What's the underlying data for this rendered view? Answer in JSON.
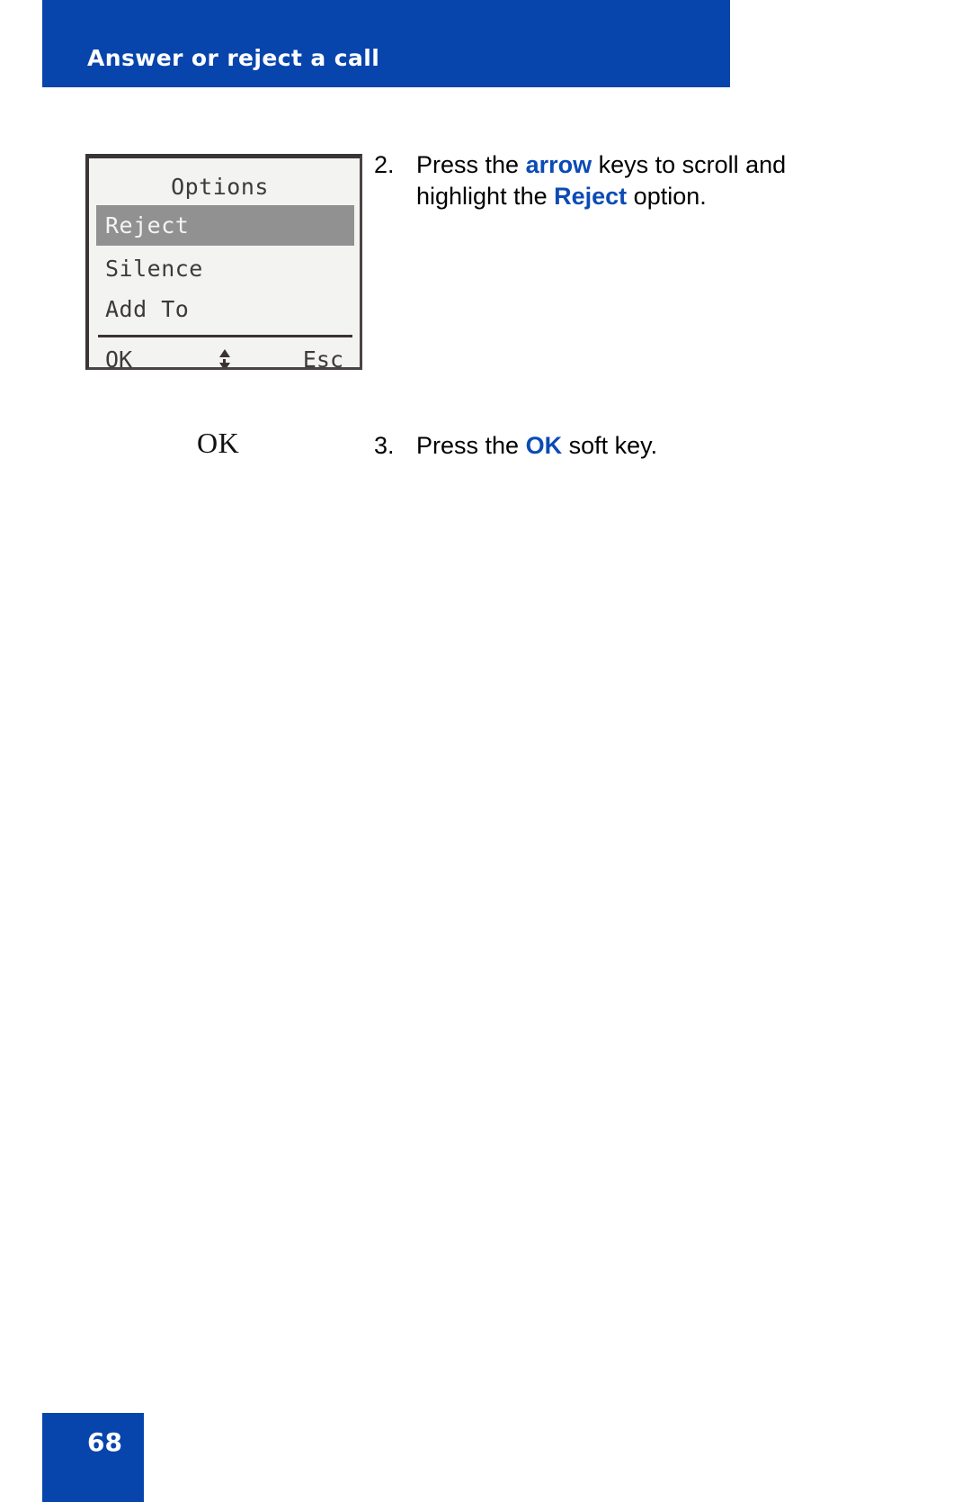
{
  "header": {
    "title": "Answer or reject a call",
    "background_color": "#0745ad",
    "text_color": "#ffffff"
  },
  "lcd_screen": {
    "title": "Options",
    "menu_items": [
      {
        "label": "Reject",
        "selected": true
      },
      {
        "label": "Silence",
        "selected": false
      },
      {
        "label": "Add To",
        "selected": false
      }
    ],
    "softkeys": {
      "left": "OK",
      "right": "Esc",
      "scroll_indicator": "up-down-arrows"
    },
    "highlight_color": "#919191",
    "screen_color": "#f3f3f1"
  },
  "softkey_glyph": {
    "label": "OK"
  },
  "steps": [
    {
      "number": "2.",
      "segments": [
        {
          "text": "Press the ",
          "highlight": false
        },
        {
          "text": "arrow",
          "highlight": true
        },
        {
          "text": " keys to scroll and highlight the ",
          "highlight": false
        },
        {
          "text": "Reject",
          "highlight": true
        },
        {
          "text": " option.",
          "highlight": false
        }
      ],
      "plain": "Press the arrow keys to scroll and highlight the Reject option."
    },
    {
      "number": "3.",
      "segments": [
        {
          "text": "Press the ",
          "highlight": false
        },
        {
          "text": "OK",
          "highlight": true
        },
        {
          "text": " soft key.",
          "highlight": false
        }
      ],
      "plain": "Press the OK soft key."
    }
  ],
  "footer": {
    "page_number": "68",
    "background_color": "#0745ad"
  },
  "accent_color": "#0b4bb5"
}
